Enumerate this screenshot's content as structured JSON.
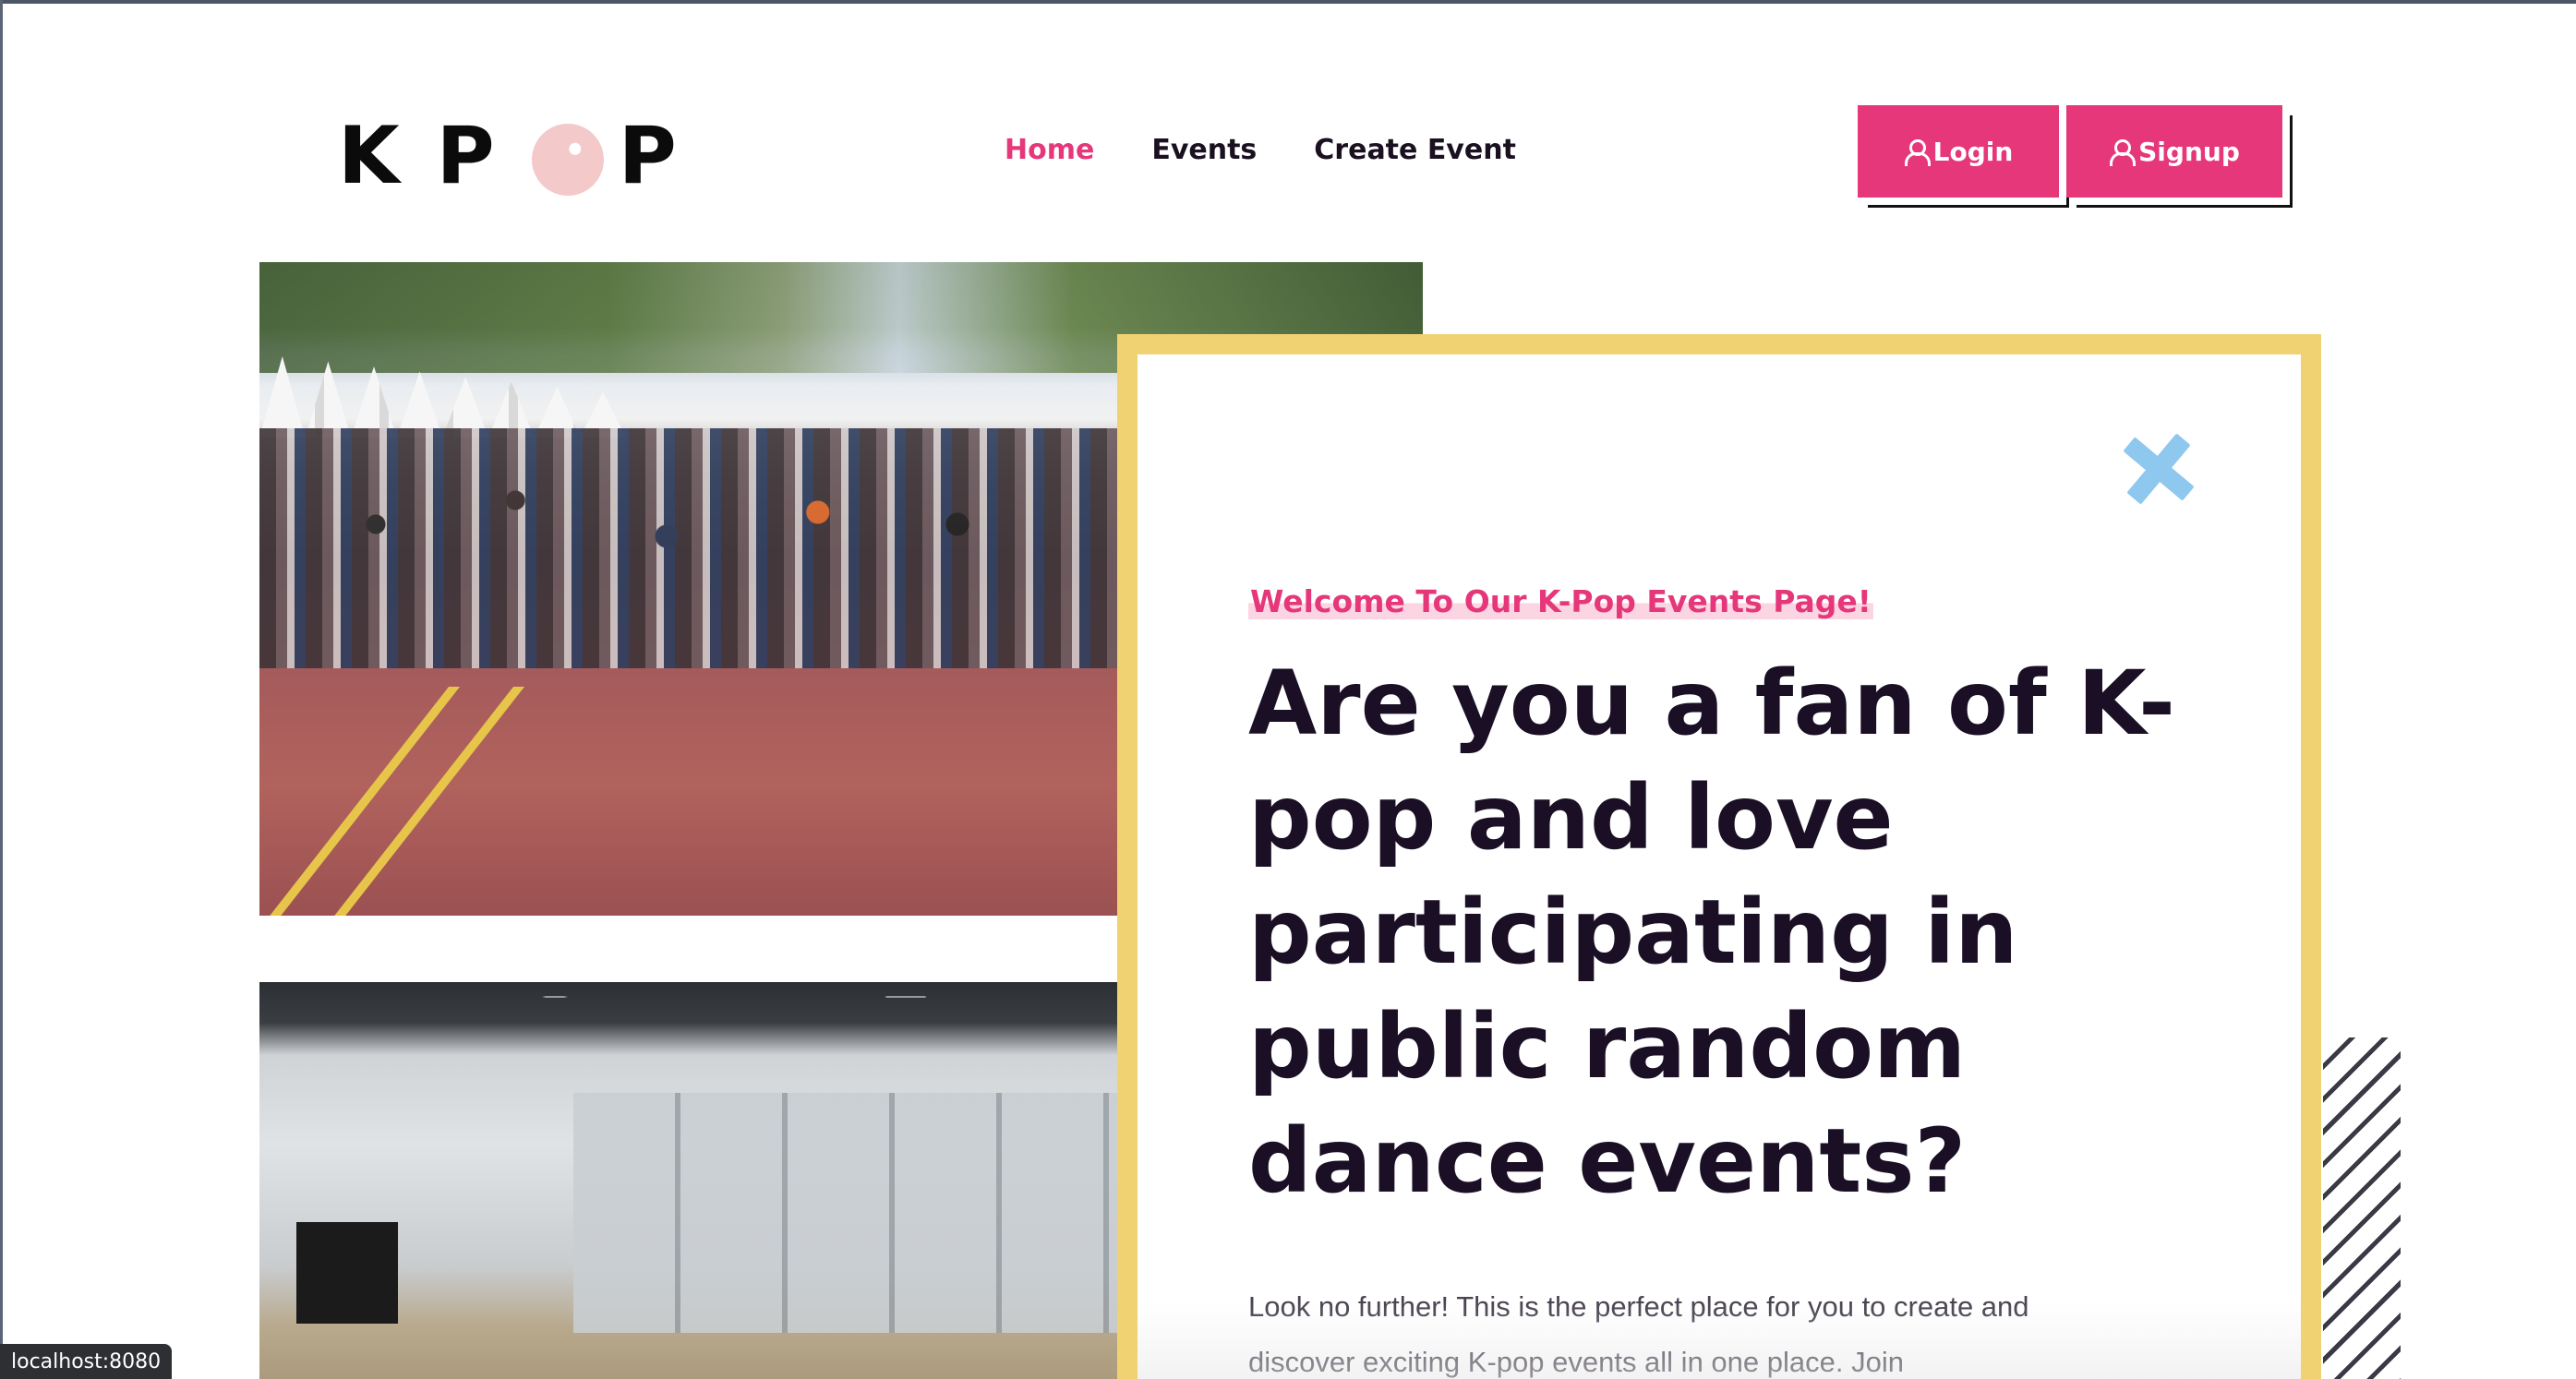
{
  "header": {
    "logo_letters": [
      "K",
      "P",
      "",
      "P"
    ],
    "nav": [
      {
        "label": "Home",
        "active": true
      },
      {
        "label": "Events",
        "active": false
      },
      {
        "label": "Create Event",
        "active": false
      }
    ],
    "login_label": "Login",
    "signup_label": "Signup",
    "accent_color": "#e5377a"
  },
  "hero": {
    "welcome": "Welcome To Our K-Pop Events Page!",
    "headline": "Are you a fan of K-pop and love participating in public random dance events?",
    "body": "Look no further! This is the perfect place for you to create and discover exciting K-pop events all in one place. Join"
  },
  "images": {
    "top_alt": "crowd-dance-photo",
    "bottom_alt": "studio-dance-photo"
  },
  "colors": {
    "card_border": "#f1d272",
    "x_icon": "#8ec8ee",
    "headline": "#1a0f24"
  },
  "status_bar": {
    "url": "localhost:8080"
  }
}
